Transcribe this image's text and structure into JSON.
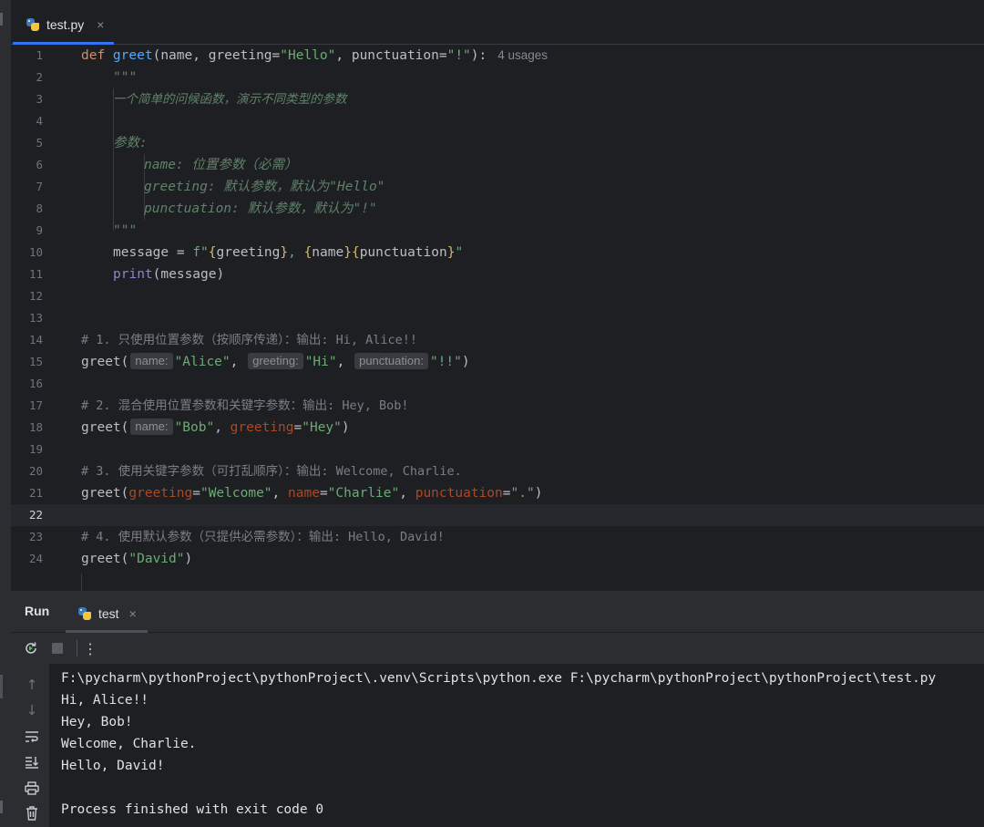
{
  "editor_tab": {
    "label": "test.py",
    "close": "×"
  },
  "editor": {
    "current_line": 22,
    "line_numbers": [
      "1",
      "2",
      "3",
      "4",
      "5",
      "6",
      "7",
      "8",
      "9",
      "10",
      "11",
      "12",
      "13",
      "14",
      "15",
      "16",
      "17",
      "18",
      "19",
      "20",
      "21",
      "22",
      "23",
      "24"
    ],
    "usages": "4 usages",
    "lines": {
      "l1": {
        "def": "def ",
        "name": "greet",
        "open": "(",
        "params": "name, greeting=",
        "default1": "\"Hello\"",
        "mid": ", punctuation=",
        "default2": "\"!\"",
        "close": "):"
      },
      "l2": "\"\"\"",
      "l3": "一个简单的问候函数，演示不同类型的参数",
      "l5": "参数:",
      "l6": "name: 位置参数（必需）",
      "l7": "greeting: 默认参数，默认为\"Hello\"",
      "l8": "punctuation: 默认参数，默认为\"!\"",
      "l9": "\"\"\"",
      "l10": {
        "lhs": "message = ",
        "f": "f\"",
        "b1": "{",
        "v1": "greeting",
        "b2": "}",
        "sep": ", ",
        "b3": "{",
        "v2": "name",
        "b4": "}",
        "b5": "{",
        "v3": "punctuation",
        "b6": "}",
        "end": "\""
      },
      "l11": {
        "fn": "print",
        "args": "(message)"
      },
      "l14": "# 1. 只使用位置参数（按顺序传递）：输出: Hi, Alice!!",
      "l15": {
        "fn": "greet(",
        "hint1": "name:",
        "a1": "\"Alice\"",
        "c1": ", ",
        "hint2": "greeting:",
        "a2": "\"Hi\"",
        "c2": ", ",
        "hint3": "punctuation:",
        "a3": "\"!!\"",
        "close": ")"
      },
      "l17": "# 2. 混合使用位置参数和关键字参数：输出: Hey, Bob!",
      "l18": {
        "fn": "greet(",
        "hint1": "name:",
        "a1": "\"Bob\"",
        "c1": ", ",
        "kw": "greeting",
        "eq": "=",
        "a2": "\"Hey\"",
        "close": ")"
      },
      "l20": "# 3. 使用关键字参数（可打乱顺序）：输出: Welcome, Charlie.",
      "l21": {
        "fn": "greet(",
        "kw1": "greeting",
        "eq1": "=",
        "a1": "\"Welcome\"",
        "c1": ", ",
        "kw2": "name",
        "eq2": "=",
        "a2": "\"Charlie\"",
        "c2": ", ",
        "kw3": "punctuation",
        "eq3": "=",
        "a3": "\".\"",
        "close": ")"
      },
      "l23": "# 4. 使用默认参数（只提供必需参数）：输出: Hello, David!",
      "l24": {
        "fn": "greet(",
        "a1": "\"David\"",
        "close": ")"
      }
    }
  },
  "run_panel": {
    "title": "Run",
    "tab": {
      "label": "test",
      "close": "×"
    },
    "toolbar": {
      "rerun_icon": "rerun-icon",
      "stop_icon": "stop-icon",
      "more": "⋮"
    },
    "console": [
      "F:\\pycharm\\pythonProject\\pythonProject\\.venv\\Scripts\\python.exe F:\\pycharm\\pythonProject\\pythonProject\\test.py",
      "Hi, Alice!!",
      "Hey, Bob!",
      "Welcome, Charlie.",
      "Hello, David!",
      "",
      "Process finished with exit code 0"
    ]
  },
  "colors": {
    "keyword": "#cf8e6d",
    "function": "#56a8f5",
    "string": "#6aab73",
    "docstring": "#5f826b",
    "comment": "#7a7e85",
    "kwarg": "#aa4926",
    "accent": "#3574f0"
  }
}
